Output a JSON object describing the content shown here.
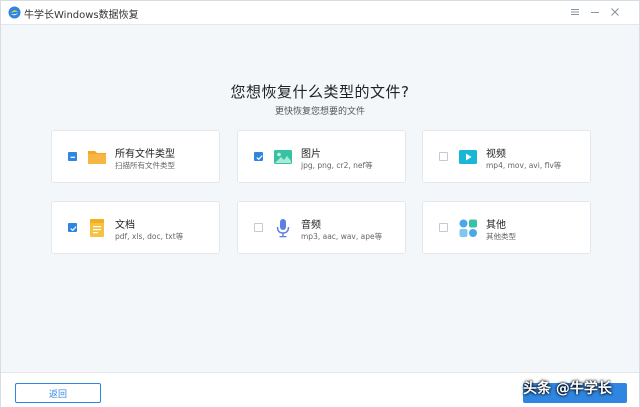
{
  "window": {
    "title": "牛学长Windows数据恢复"
  },
  "header": {
    "title": "您想恢复什么类型的文件?",
    "subtitle": "更快恢复您想要的文件"
  },
  "file_types": [
    {
      "label": "所有文件类型",
      "description": "扫描所有文件类型",
      "state": "partial"
    },
    {
      "label": "图片",
      "description": "jpg, png, cr2, nef等",
      "state": "checked"
    },
    {
      "label": "视频",
      "description": "mp4, mov, avi, flv等",
      "state": "unchecked"
    },
    {
      "label": "文档",
      "description": "pdf, xls, doc, txt等",
      "state": "checked"
    },
    {
      "label": "音频",
      "description": "mp3, aac, wav, ape等",
      "state": "unchecked"
    },
    {
      "label": "其他",
      "description": "其他类型",
      "state": "unchecked"
    }
  ],
  "footer": {
    "back_label": "返回"
  },
  "watermark": "头条 @牛学长",
  "colors": {
    "accent": "#2f86e0",
    "folder": "#f5a623",
    "image": "#36c2a3",
    "video": "#19b7d6",
    "document": "#f6c243",
    "audio": "#5d7fe3",
    "other": "#4aa8e8"
  }
}
